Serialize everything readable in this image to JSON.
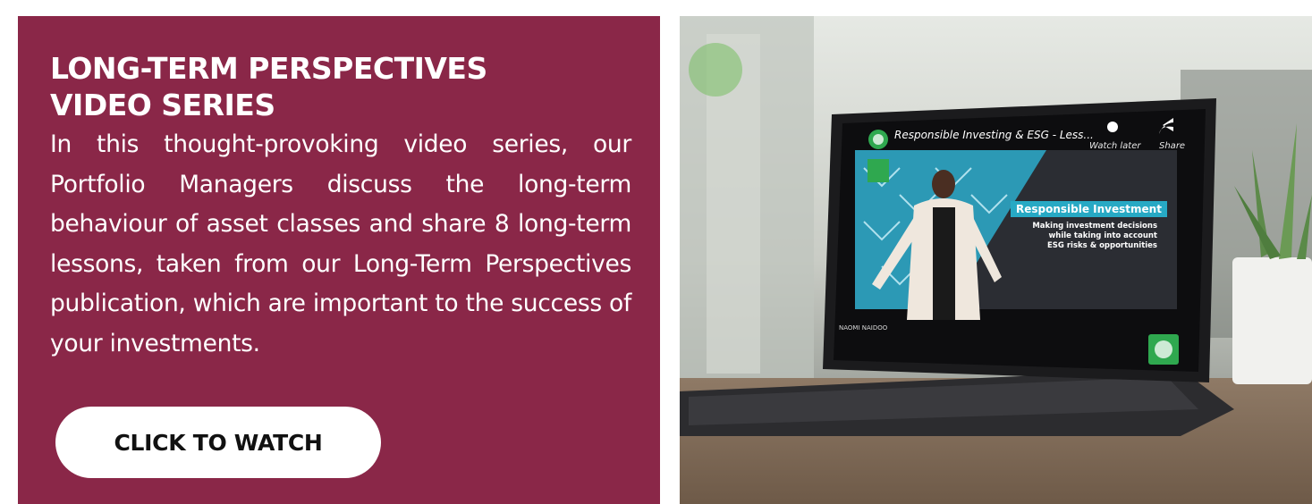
{
  "banner": {
    "heading_line1": "LONG-TERM PERSPECTIVES",
    "heading_line2": "VIDEO SERIES",
    "description": "In this thought-provoking video series, our Portfolio Managers discuss the long-term behaviour of asset classes and share 8 long-term lessons, taken from our Long-Term Perspectives publication, which are important to the success of your investments.",
    "cta_label": "CLICK TO WATCH",
    "background_color": "#8a2748",
    "button_color": "#ffffff"
  },
  "video_thumbnail": {
    "video_title": "Responsible Investing & ESG - Less...",
    "watch_later_label": "Watch later",
    "share_label": "Share",
    "slide_title": "Responsible Investment",
    "slide_subtitle_line1": "Making investment decisions",
    "slide_subtitle_line2": "while taking into account",
    "slide_subtitle_line3": "ESG risks & opportunities",
    "speaker_name": "NAOMI NAIDOO",
    "icons": [
      "channel-logo-icon",
      "clock-icon",
      "share-arrow-icon",
      "brand-logo-icon"
    ],
    "accent_color": "#27a9c4"
  }
}
